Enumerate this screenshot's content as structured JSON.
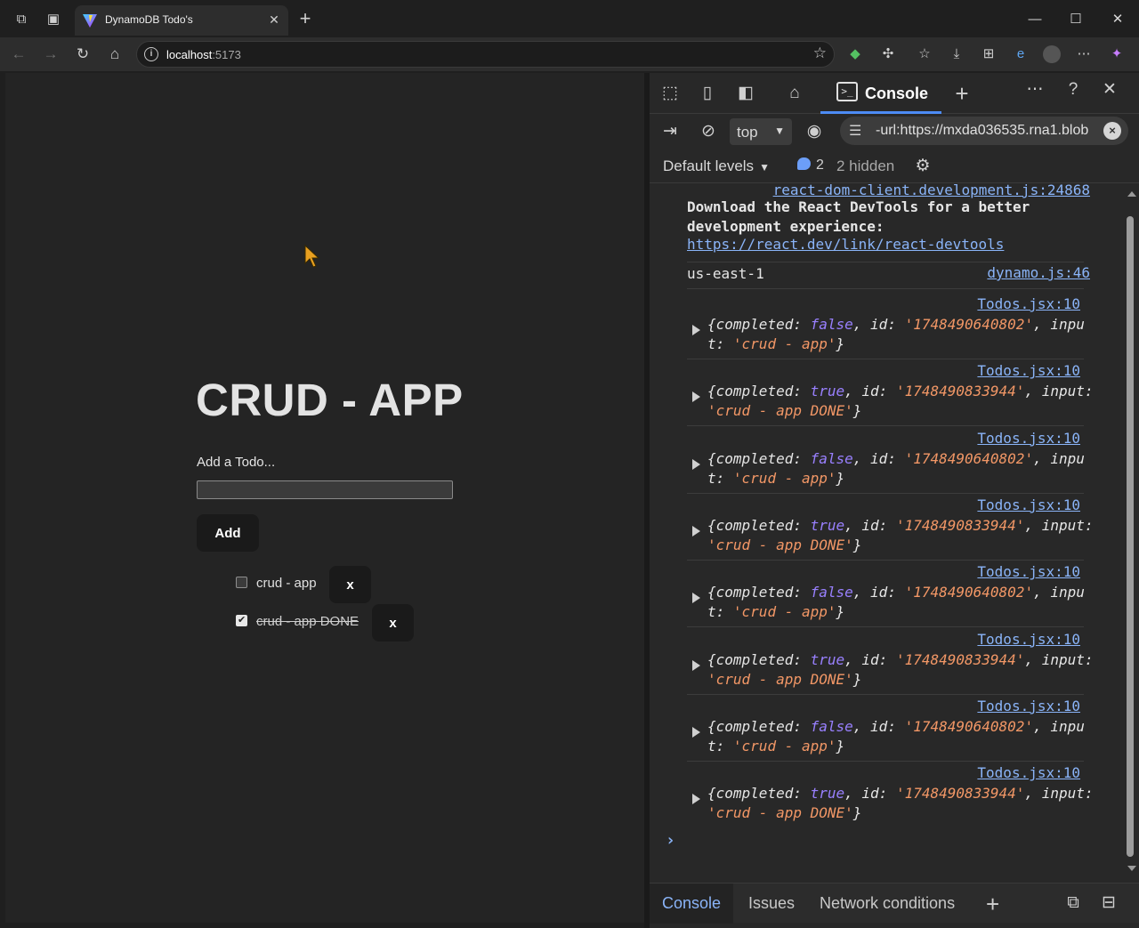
{
  "browser": {
    "tab_title": "DynamoDB Todo's",
    "url_host": "localhost",
    "url_port": ":5173"
  },
  "app": {
    "title": "CRUD - APP",
    "input_label": "Add a Todo...",
    "input_value": "",
    "add_button": "Add",
    "todos": [
      {
        "text": "crud - app",
        "completed": false,
        "delete_label": "x"
      },
      {
        "text": "crud - app DONE",
        "completed": true,
        "delete_label": "x"
      }
    ]
  },
  "devtools": {
    "console_tab": "Console",
    "context": "top",
    "filter_text": "-url:https://mxda036535.rna1.blob",
    "levels": "Default levels",
    "message_count": "2",
    "hidden": "2 hidden",
    "log": {
      "top_source": "react-dom-client.development.js:24868",
      "react_msg": "Download the React DevTools for a better development experience:",
      "react_link": "https://react.dev/link/react-devtools",
      "region_text": "us-east-1",
      "region_source": "dynamo.js:46",
      "entries": [
        {
          "source": "Todos.jsx:10",
          "completed": "false",
          "id": "'1748490640802'",
          "input": "'crud - app'"
        },
        {
          "source": "Todos.jsx:10",
          "completed": "true",
          "id": "'1748490833944'",
          "input": "'crud - app DONE'"
        },
        {
          "source": "Todos.jsx:10",
          "completed": "false",
          "id": "'1748490640802'",
          "input": "'crud - app'"
        },
        {
          "source": "Todos.jsx:10",
          "completed": "true",
          "id": "'1748490833944'",
          "input": "'crud - app DONE'"
        },
        {
          "source": "Todos.jsx:10",
          "completed": "false",
          "id": "'1748490640802'",
          "input": "'crud - app'"
        },
        {
          "source": "Todos.jsx:10",
          "completed": "true",
          "id": "'1748490833944'",
          "input": "'crud - app DONE'"
        },
        {
          "source": "Todos.jsx:10",
          "completed": "false",
          "id": "'1748490640802'",
          "input": "'crud - app'"
        },
        {
          "source": "Todos.jsx:10",
          "completed": "true",
          "id": "'1748490833944'",
          "input": "'crud - app DONE'"
        }
      ]
    },
    "bottom_tabs": [
      "Console",
      "Issues",
      "Network conditions"
    ]
  }
}
